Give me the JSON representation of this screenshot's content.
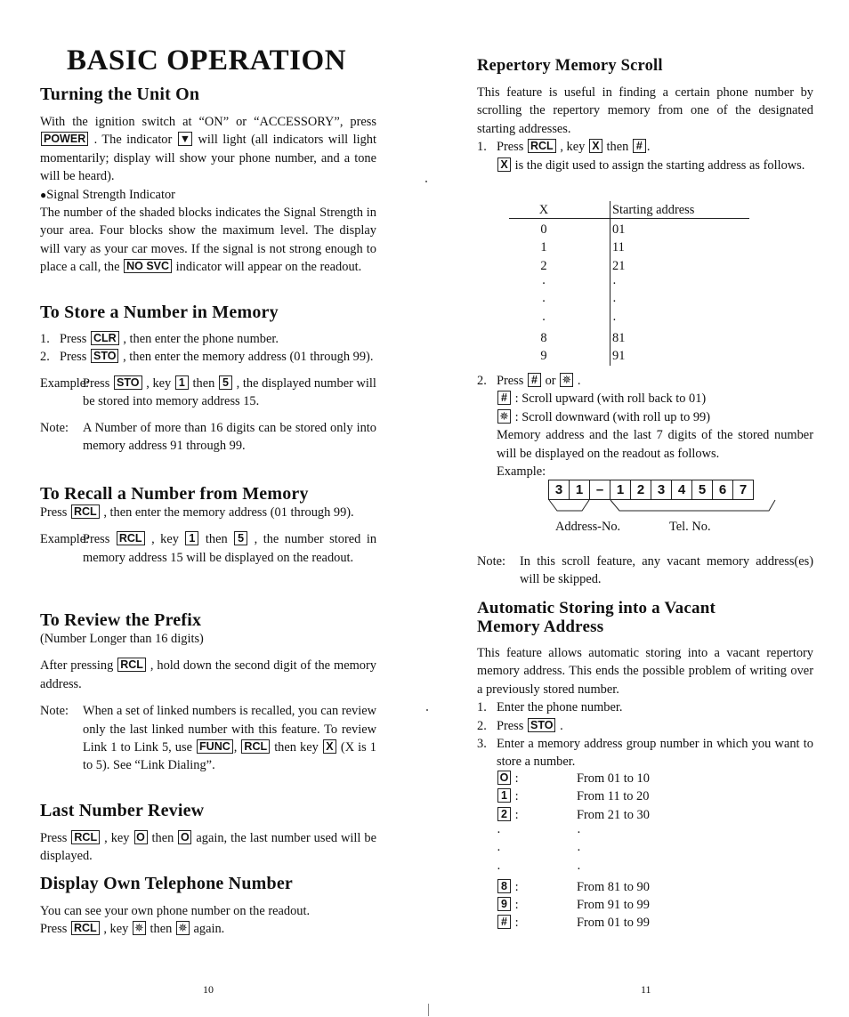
{
  "left_page": {
    "main_title": "BASIC OPERATION",
    "turning_on": {
      "heading": "Turning the Unit On",
      "p1_a": "With the ignition switch at “ON” or “ACCESSORY”, press",
      "key_power": "POWER",
      "p1_b": ". The indicator",
      "indicator_icon": "antenna-signal-icon",
      "p1_c": "will light (all indicators will light momentarily; display will show your phone number, and a tone will be heard).",
      "bullet_label": "Signal Strength Indicator",
      "p2": "The number of the shaded blocks indicates the Signal Strength in your area. Four blocks show the maximum level. The display will vary as your car moves. If the signal is not strong enough to place a call, the",
      "key_nosvc": "NO SVC",
      "p2_end": "indicator will appear on the readout."
    },
    "store": {
      "heading": "To Store a Number in Memory",
      "step1_num": "1.",
      "step1_a": "Press",
      "step1_key": "CLR",
      "step1_b": ", then enter the phone number.",
      "step2_num": "2.",
      "step2_a": "Press",
      "step2_key": "STO",
      "step2_b": ", then enter the memory address (01 through 99).",
      "example_lead": "Example:",
      "example_a": "Press",
      "example_key1": "STO",
      "example_b": ", key",
      "example_key2": "1",
      "example_c": "then",
      "example_key3": "5",
      "example_d": ", the displayed number will be stored into memory address 15.",
      "note_lead": "Note:",
      "note_text": "A Number of more than 16 digits can be stored only into memory address 91 through 99."
    },
    "recall": {
      "heading": "To Recall a Number from Memory",
      "p_a": "Press",
      "p_key": "RCL",
      "p_b": ", then enter the memory address (01 through 99).",
      "example_lead": "Example:",
      "example_a": "Press",
      "example_key1": "RCL",
      "example_b": ", key",
      "example_key2": "1",
      "example_c": "then",
      "example_key3": "5",
      "example_d": ", the number stored in memory address 15 will be displayed on the readout."
    },
    "prefix": {
      "heading": "To Review the Prefix",
      "subheading": "(Number Longer than 16 digits)",
      "p_a": "After pressing",
      "p_key": "RCL",
      "p_b": ", hold down the second digit of the memory address.",
      "note_lead": "Note:",
      "note_a": "When a set of linked numbers is recalled, you can review only the last linked number with this feature.  To review Link 1 to Link 5, use",
      "note_key1": "FUNC",
      "note_b": ",",
      "note_key2": "RCL",
      "note_c": "then key",
      "note_key3": "X",
      "note_d": "(X is 1 to 5).  See “Link Dialing”."
    },
    "last_number": {
      "heading": "Last Number Review",
      "p_a": "Press",
      "p_key1": "RCL",
      "p_b": ", key",
      "p_key2": "O",
      "p_c": "then",
      "p_key3": "O",
      "p_d": "again, the last number used will be displayed."
    },
    "own_number": {
      "heading": "Display Own Telephone Number",
      "p1": "You can see your own phone number on the readout.",
      "p2_a": "Press",
      "p2_key1": "RCL",
      "p2_b": ", key",
      "p2_key2": "✵",
      "p2_c": "then",
      "p2_key3": "✵",
      "p2_d": "again."
    },
    "page_number": "10"
  },
  "right_page": {
    "scroll": {
      "heading": "Repertory Memory Scroll",
      "intro": "This feature is useful in finding a certain phone number by scrolling the repertory memory from one of the designated starting addresses.",
      "step1_num": "1.",
      "step1_a": "Press",
      "step1_key1": "RCL",
      "step1_b": ", key",
      "step1_key2": "X",
      "step1_c": "then",
      "step1_key3": "#",
      "step1_d": ".",
      "x_key": "X",
      "x_desc": "is the digit used to assign the starting address as follows.",
      "table": {
        "headers": [
          "X",
          "Starting address"
        ],
        "rows": [
          [
            "0",
            "01"
          ],
          [
            "1",
            "11"
          ],
          [
            "2",
            "21"
          ],
          [
            "·",
            "·"
          ],
          [
            "·",
            "·"
          ],
          [
            "·",
            "·"
          ],
          [
            "8",
            "81"
          ],
          [
            "9",
            "91"
          ]
        ]
      },
      "step2_num": "2.",
      "step2_a": "Press",
      "step2_key1": "#",
      "step2_b": "or",
      "step2_key2": "✵",
      "step2_c": ".",
      "hash_key": "#",
      "hash_desc": ": Scroll upward (with roll back to 01)",
      "star_key": "✵",
      "star_desc": ": Scroll downward (with roll up to 99)",
      "display_desc": "Memory address and the last 7 digits of the stored number will be displayed on the readout as follows.",
      "example_label": "Example:",
      "readout_cells": [
        "3",
        "1",
        "–",
        "1",
        "2",
        "3",
        "4",
        "5",
        "6",
        "7"
      ],
      "address_label": "Address-No.",
      "tel_label": "Tel. No.",
      "note_lead": "Note:",
      "note_text": "In this scroll feature, any vacant memory address(es) will be skipped."
    },
    "auto_store": {
      "heading_line1": "Automatic Storing into a Vacant",
      "heading_line2": "Memory Address",
      "intro": "This feature allows automatic storing into a vacant repertory memory address. This ends the possible problem of writing over a previously stored number.",
      "step1_num": "1.",
      "step1": "Enter the phone number.",
      "step2_num": "2.",
      "step2_a": "Press",
      "step2_key": "STO",
      "step2_b": ".",
      "step3_num": "3.",
      "step3": "Enter a memory address group number in which you want to store a number.",
      "groups": [
        {
          "key": "O",
          "range": "From 01 to 10"
        },
        {
          "key": "1",
          "range": "From 11 to 20"
        },
        {
          "key": "2",
          "range": "From 21 to 30"
        },
        {
          "key": "·",
          "range": "·"
        },
        {
          "key": "·",
          "range": "·"
        },
        {
          "key": "·",
          "range": "·"
        },
        {
          "key": "8",
          "range": "From 81 to 90"
        },
        {
          "key": "9",
          "range": "From 91 to 99"
        },
        {
          "key": "#",
          "range": "From 01 to 99"
        }
      ]
    },
    "page_number": "11"
  }
}
